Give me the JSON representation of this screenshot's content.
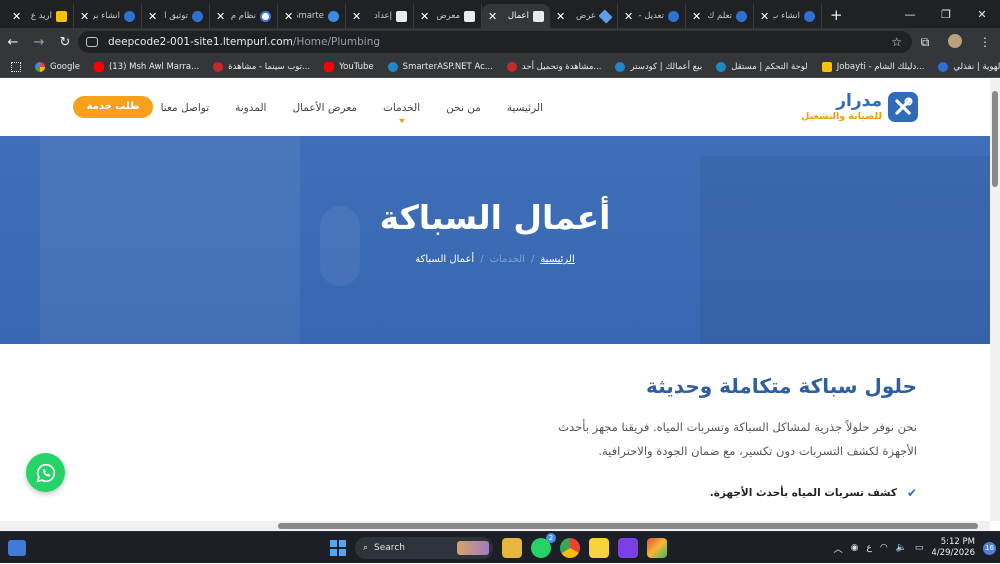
{
  "browser": {
    "tabs": [
      {
        "label": "اريد ع",
        "icon": "bookmark-yellow-icon"
      },
      {
        "label": "انشاء بر",
        "icon": "site-favicon-icon"
      },
      {
        "label": "توثيق ا",
        "icon": "site-favicon-icon"
      },
      {
        "label": "نظام م",
        "icon": "globe-icon"
      },
      {
        "label": "Smarte",
        "icon": "smarterasp-icon"
      },
      {
        "label": "إعداد",
        "icon": "document-icon"
      },
      {
        "label": "معرض",
        "icon": "document-icon"
      },
      {
        "label": "أعمال",
        "icon": "document-icon",
        "active": true
      },
      {
        "label": "عرض",
        "icon": "gemini-icon"
      },
      {
        "label": "تعديل -",
        "icon": "site-favicon-icon"
      },
      {
        "label": "تعلم ك",
        "icon": "site-favicon-icon"
      },
      {
        "label": "انشاء ب",
        "icon": "site-favicon-icon"
      }
    ],
    "url_host": "deepcode2-001-site1.ltempurl.com",
    "url_path": "/Home/Plumbing",
    "bookmarks": [
      {
        "label": "Google",
        "icon": "google-icon"
      },
      {
        "label": "(13) Msh Awl Marra...",
        "icon": "youtube-icon"
      },
      {
        "label": "توب سينما - مشاهدة...",
        "icon": "flag-icon"
      },
      {
        "label": "YouTube",
        "icon": "youtube-icon"
      },
      {
        "label": "SmarterASP.NET Ac...",
        "icon": "smarterasp-icon"
      },
      {
        "label": "مشاهدة وتحميل أحد...",
        "icon": "red-site-icon"
      },
      {
        "label": "بيع أعمالك | كودستر",
        "icon": "codester-icon"
      },
      {
        "label": "لوحة التحكم | مستقل",
        "icon": "mostaql-icon"
      },
      {
        "label": "Jobayti - دليلك الشام...",
        "icon": "jobayti-icon"
      },
      {
        "label": "توثيق الهوية | نفذلي",
        "icon": "site-favicon-icon"
      }
    ]
  },
  "site": {
    "logo_title": "مدرار",
    "logo_subtitle": "للصيانة والتشغيل",
    "nav": [
      "الرئيسية",
      "من نحن",
      "الخدمات",
      "معرض الأعمال",
      "المدونة",
      "تواصل معنا"
    ],
    "cta_label": "طلب خدمة"
  },
  "hero": {
    "title": "أعمال السباكة",
    "breadcrumb_home": "الرئيسية",
    "breadcrumb_mid": "الخدمات",
    "breadcrumb_current": "أعمال السباكة"
  },
  "content": {
    "section_title": "حلول سباكة متكاملة وحديثة",
    "paragraph": "نحن نوفر حلولاً جذرية لمشاكل السباكة وتسربات المياه. فريقنا مجهز بأحدث الأجهزة لكشف التسربات دون تكسير، مع ضمان الجودة والاحترافية.",
    "feature_1": "كشف تسربات المياه بأحدث الأجهزة."
  },
  "taskbar": {
    "search_label": "Search",
    "whatsapp_badge": "2",
    "lang": "ع",
    "time": "5:12 PM",
    "date": "4/29/2026",
    "notif_count": "16"
  },
  "colors": {
    "brand_blue": "#2f6bb8",
    "brand_orange": "#f7a11a",
    "hero_blue": "#3a69b5"
  }
}
